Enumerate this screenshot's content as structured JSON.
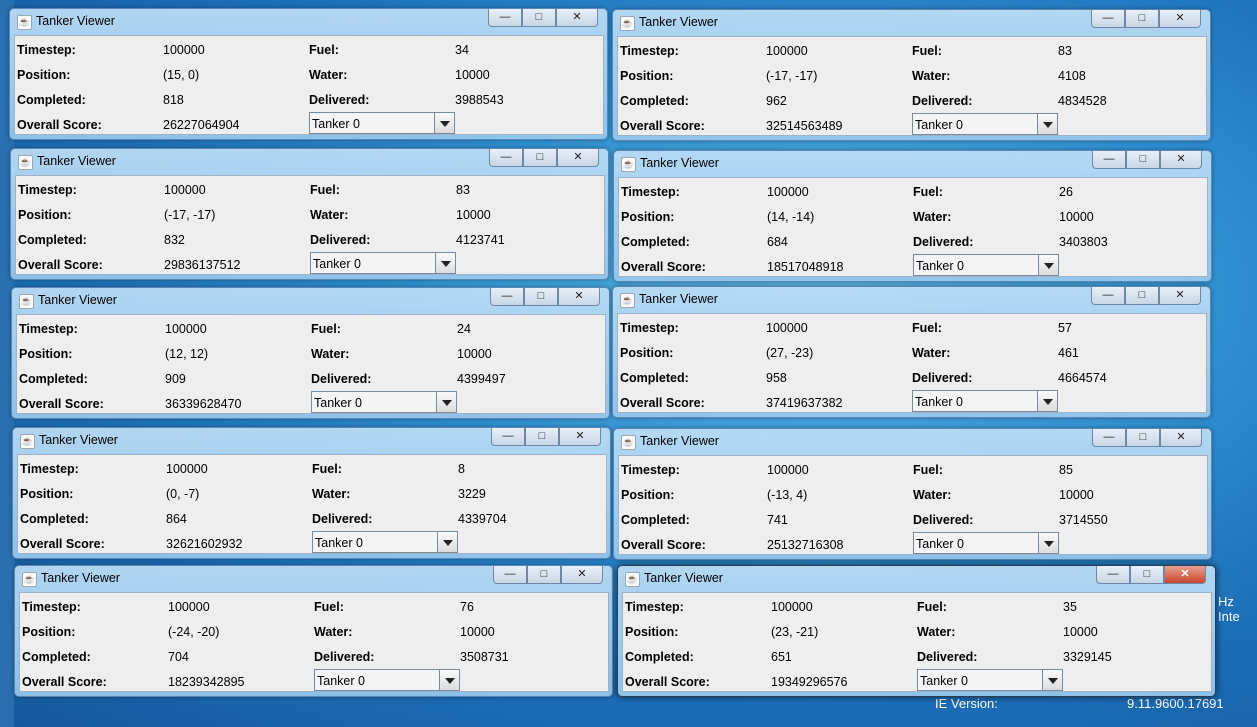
{
  "desktop": {
    "right_text": "Hz Inte",
    "bottom_mid_text": "IE Version:",
    "bottom_right_text": "9.11.9600.17691"
  },
  "labels": {
    "timestep": "Timestep:",
    "position": "Position:",
    "completed": "Completed:",
    "overall_score": "Overall Score:",
    "fuel": "Fuel:",
    "water": "Water:",
    "delivered": "Delivered:"
  },
  "controls": {
    "minimize": "—",
    "maximize": "□",
    "close": "✕"
  },
  "windows": [
    {
      "title": "Tanker Viewer",
      "timestep": "100000",
      "position": "(15, 0)",
      "completed": "818",
      "overall_score": "26227064904",
      "fuel": "34",
      "water": "10000",
      "delivered": "3988543",
      "tanker": "Tanker 0"
    },
    {
      "title": "Tanker Viewer",
      "timestep": "100000",
      "position": "(-17, -17)",
      "completed": "962",
      "overall_score": "32514563489",
      "fuel": "83",
      "water": "4108",
      "delivered": "4834528",
      "tanker": "Tanker 0"
    },
    {
      "title": "Tanker Viewer",
      "timestep": "100000",
      "position": "(-17, -17)",
      "completed": "832",
      "overall_score": "29836137512",
      "fuel": "83",
      "water": "10000",
      "delivered": "4123741",
      "tanker": "Tanker 0"
    },
    {
      "title": "Tanker Viewer",
      "timestep": "100000",
      "position": "(14, -14)",
      "completed": "684",
      "overall_score": "18517048918",
      "fuel": "26",
      "water": "10000",
      "delivered": "3403803",
      "tanker": "Tanker 0"
    },
    {
      "title": "Tanker Viewer",
      "timestep": "100000",
      "position": "(12, 12)",
      "completed": "909",
      "overall_score": "36339628470",
      "fuel": "24",
      "water": "10000",
      "delivered": "4399497",
      "tanker": "Tanker 0"
    },
    {
      "title": "Tanker Viewer",
      "timestep": "100000",
      "position": "(27, -23)",
      "completed": "958",
      "overall_score": "37419637382",
      "fuel": "57",
      "water": "461",
      "delivered": "4664574",
      "tanker": "Tanker 0"
    },
    {
      "title": "Tanker Viewer",
      "timestep": "100000",
      "position": "(0, -7)",
      "completed": "864",
      "overall_score": "32621602932",
      "fuel": "8",
      "water": "3229",
      "delivered": "4339704",
      "tanker": "Tanker 0"
    },
    {
      "title": "Tanker Viewer",
      "timestep": "100000",
      "position": "(-13, 4)",
      "completed": "741",
      "overall_score": "25132716308",
      "fuel": "85",
      "water": "10000",
      "delivered": "3714550",
      "tanker": "Tanker 0"
    },
    {
      "title": "Tanker Viewer",
      "timestep": "100000",
      "position": "(-24, -20)",
      "completed": "704",
      "overall_score": "18239342895",
      "fuel": "76",
      "water": "10000",
      "delivered": "3508731",
      "tanker": "Tanker 0"
    },
    {
      "title": "Tanker Viewer",
      "timestep": "100000",
      "position": "(23, -21)",
      "completed": "651",
      "overall_score": "19349296576",
      "fuel": "35",
      "water": "10000",
      "delivered": "3329145",
      "tanker": "Tanker 0"
    }
  ]
}
